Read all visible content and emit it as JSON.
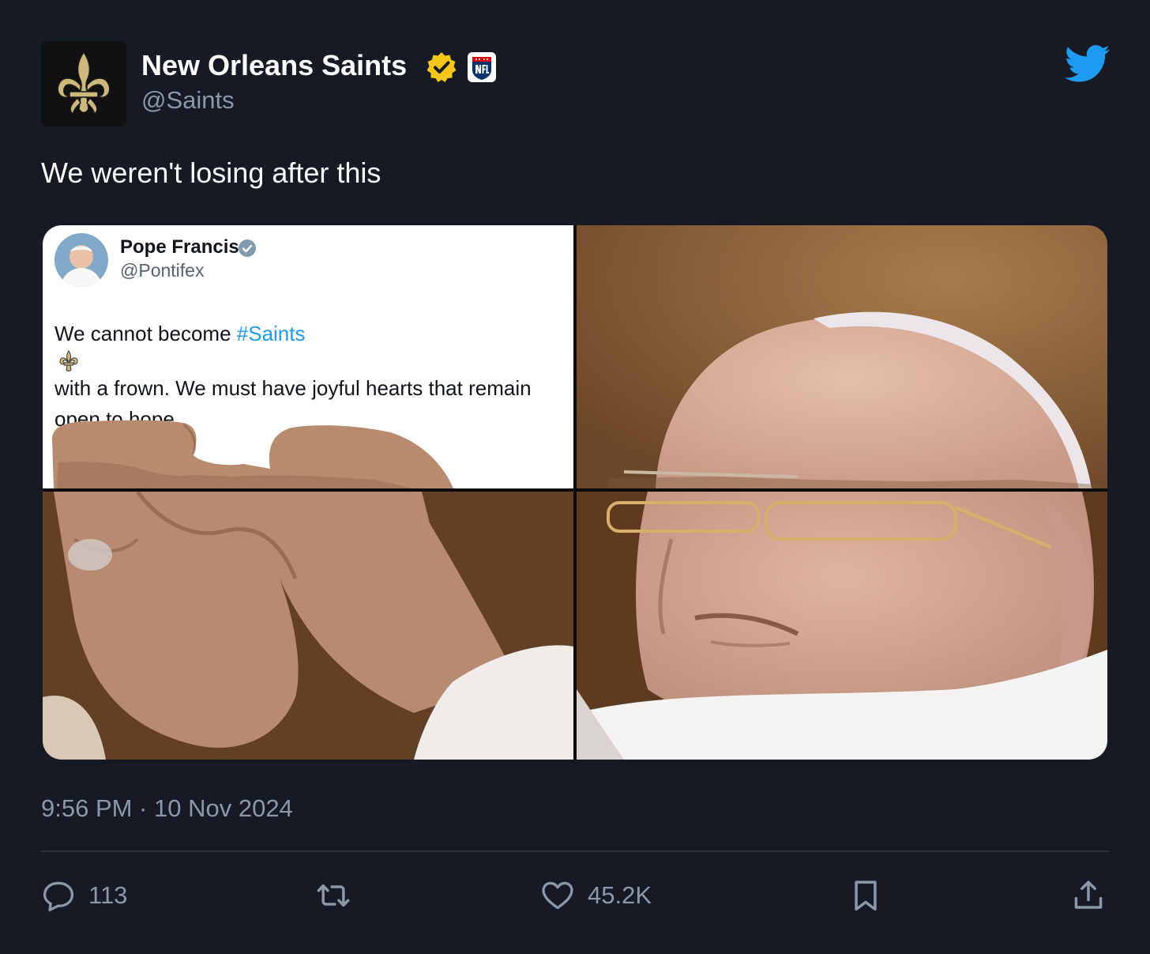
{
  "tweet": {
    "display_name": "New Orleans Saints",
    "handle": "@Saints",
    "text": "We weren't losing after this",
    "timestamp": "9:56 PM · 10 Nov 2024",
    "brand_color": "#1d9bf0"
  },
  "embedded": {
    "display_name": "Pope Francis",
    "handle": "@Pontifex",
    "text_before": "We cannot become ",
    "hashtag": "#Saints",
    "text_after": " with a frown. We must have joyful hearts that remain open to hope."
  },
  "actions": {
    "reply_count": "113",
    "like_count": "45.2K"
  },
  "icons": [
    "fleur-de-lis-icon",
    "verified-badge-icon",
    "nfl-badge-icon",
    "twitter-bird-icon",
    "reply-icon",
    "retweet-icon",
    "like-icon",
    "bookmark-icon",
    "share-icon"
  ]
}
